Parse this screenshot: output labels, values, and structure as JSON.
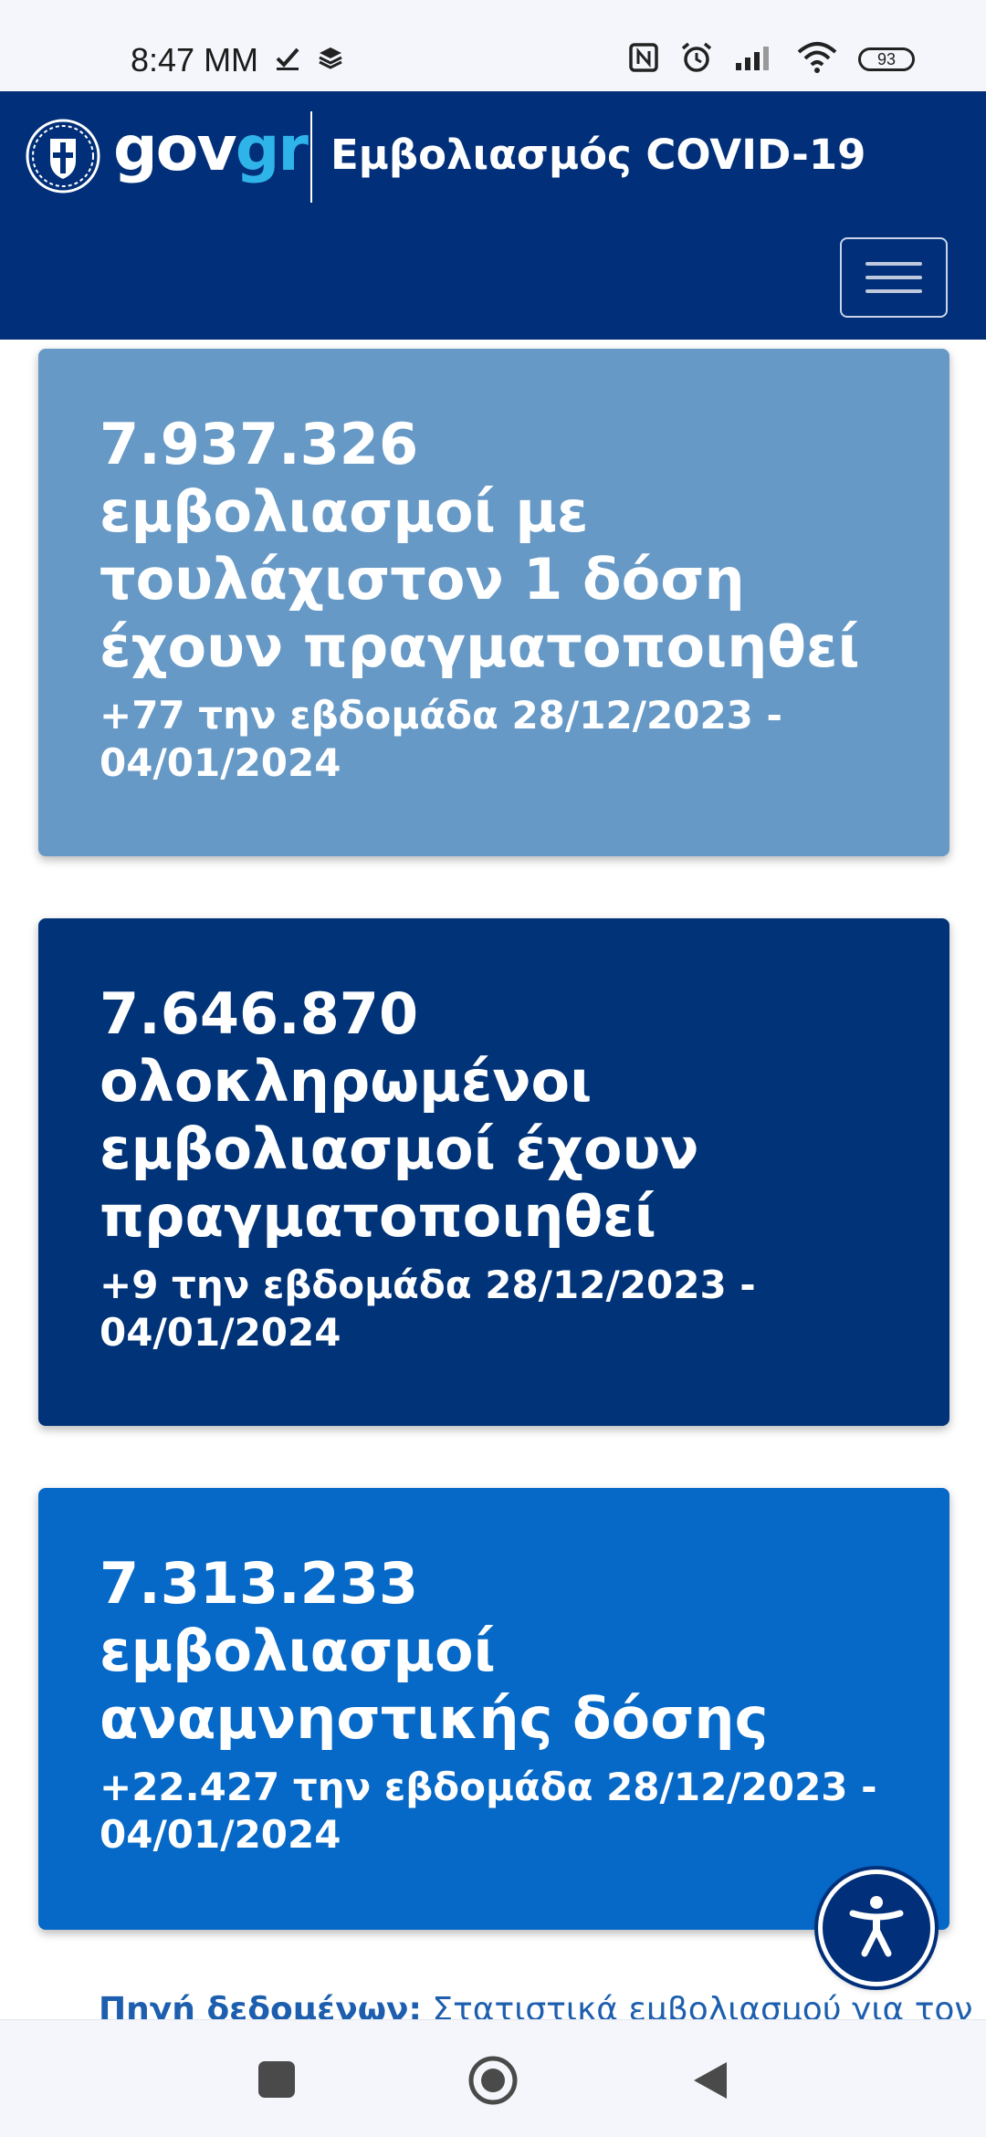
{
  "status_bar": {
    "time": "8:47 MM",
    "battery": "93",
    "icons": [
      "check-icon",
      "layers-icon",
      "nfc-icon",
      "alarm-icon",
      "signal-icon",
      "wifi-icon",
      "battery-icon"
    ]
  },
  "header": {
    "logo_gov": "gov",
    "logo_gr": "gr",
    "title": "Εμβολιασμός COVID-19",
    "menu_icon": "hamburger-menu-icon"
  },
  "cards": [
    {
      "number": "7.937.326",
      "text": "εμβολιασμοί με τουλάχιστον 1 δόση έχουν πραγματοποιηθεί",
      "sub": "+77 την εβδομάδα 28/12/2023 - 04/01/2024",
      "color": "#6699c6"
    },
    {
      "number": "7.646.870",
      "text": "ολοκληρωμένοι εμβολιασμοί έχουν πραγματοποιηθεί",
      "sub": "+9 την εβδομάδα 28/12/2023 - 04/01/2024",
      "color": "#003377"
    },
    {
      "number": "7.313.233",
      "text": "εμβολιασμοί αναμνηστικής δόσης",
      "sub": "+22.427 την εβδομάδα 28/12/2023 - 04/01/2024",
      "color": "#0669c7"
    }
  ],
  "source": {
    "label": "Πηγή δεδομένων:",
    "link": "Στατιστικά εμβολιασμού για τον"
  },
  "accessibility": {
    "icon": "accessibility-icon"
  },
  "nav": {
    "icons": [
      "recent-apps-icon",
      "home-icon",
      "back-icon"
    ]
  },
  "colors": {
    "header": "#012f79",
    "logo_accent": "#2fb4ea",
    "source_link": "#1d5fae"
  }
}
